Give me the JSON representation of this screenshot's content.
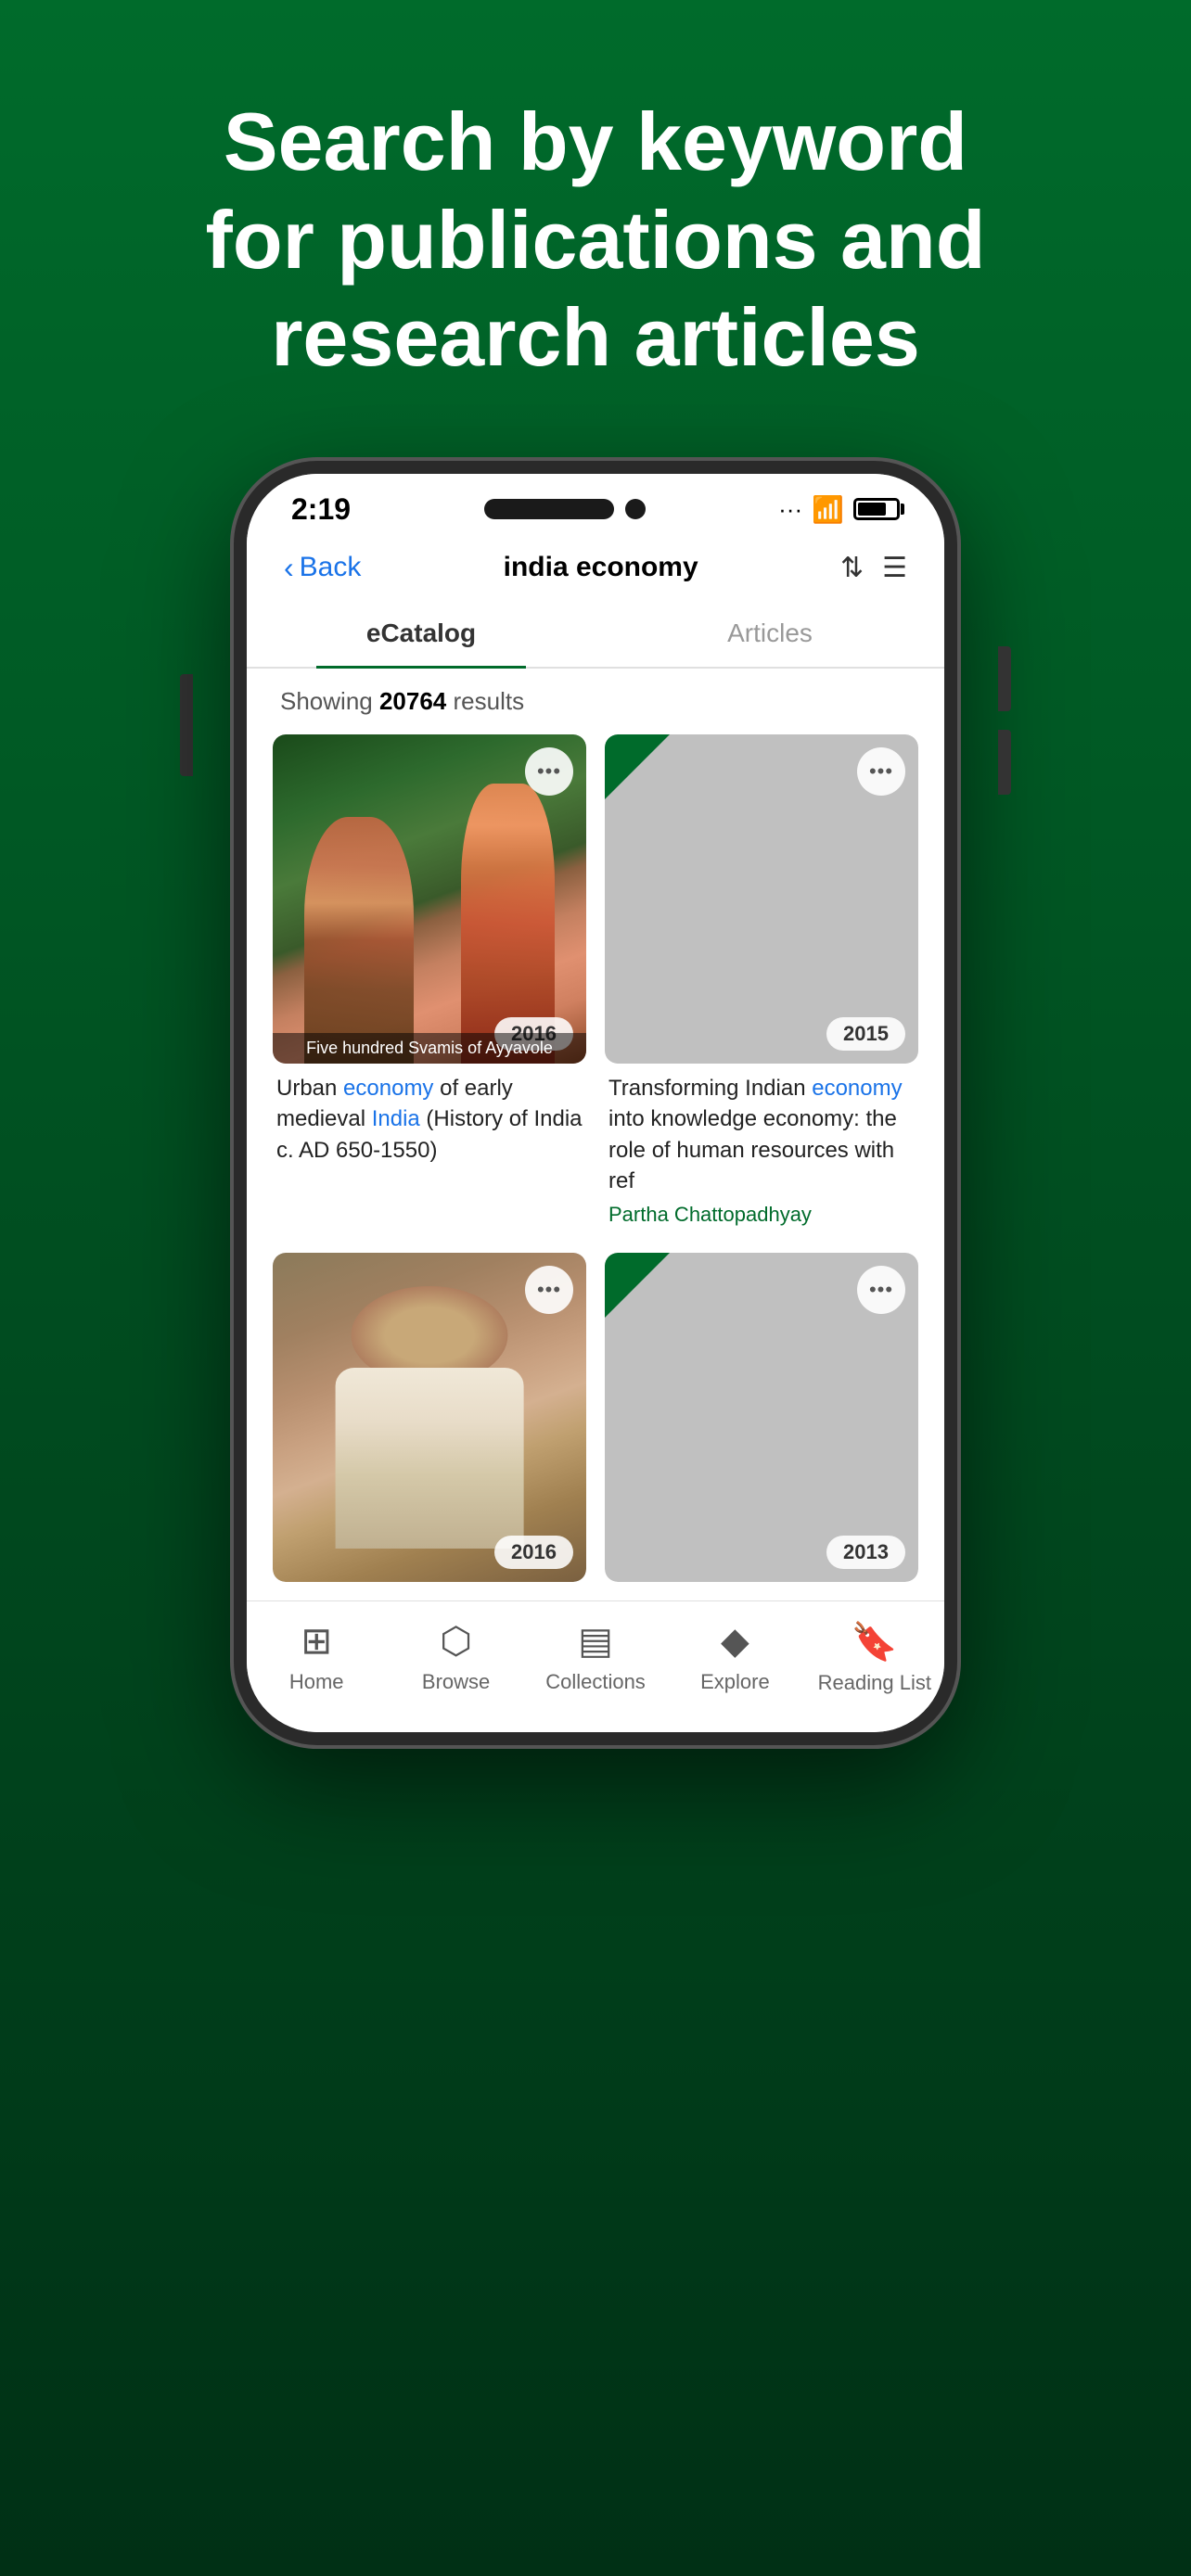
{
  "hero": {
    "text": "Search by keyword for publications and research articles"
  },
  "phone": {
    "status": {
      "time": "2:19"
    },
    "nav": {
      "back_label": "Back",
      "search_query": "india economy",
      "sort_label": "sort",
      "filter_label": "filter"
    },
    "tabs": [
      {
        "label": "eCatalog",
        "active": true
      },
      {
        "label": "Articles",
        "active": false
      }
    ],
    "results": {
      "count": "20764",
      "prefix": "Showing ",
      "suffix": " results"
    },
    "cards": [
      {
        "id": "card-1",
        "type": "photo",
        "year": "2016",
        "title_parts": [
          {
            "text": "Urban ",
            "highlight": false
          },
          {
            "text": "economy",
            "highlight": true
          },
          {
            "text": " of early medieval ",
            "highlight": false
          },
          {
            "text": "India",
            "highlight": true
          },
          {
            "text": " (History of India c. AD 650-1550)",
            "highlight": false
          }
        ],
        "caption": "Five hundred Svamis of Ayyavole"
      },
      {
        "id": "card-2",
        "type": "placeholder",
        "year": "2015",
        "title_parts": [
          {
            "text": "Transforming Indian ",
            "highlight": false
          },
          {
            "text": "economy",
            "highlight": true
          },
          {
            "text": " into knowledge economy: the role of human resources with ref",
            "highlight": false
          }
        ],
        "author": "Partha Chattopadhyay"
      },
      {
        "id": "card-3",
        "type": "photo",
        "year": "2016",
        "title_parts": []
      },
      {
        "id": "card-4",
        "type": "placeholder",
        "year": "2013",
        "title_parts": []
      }
    ],
    "bottom_nav": [
      {
        "id": "home",
        "label": "Home",
        "icon": "🏠"
      },
      {
        "id": "browse",
        "label": "Browse",
        "icon": "⬆"
      },
      {
        "id": "collections",
        "label": "Collections",
        "icon": "📋"
      },
      {
        "id": "explore",
        "label": "Explore",
        "icon": "◆"
      },
      {
        "id": "reading-list",
        "label": "Reading List",
        "icon": "🔖"
      }
    ]
  }
}
